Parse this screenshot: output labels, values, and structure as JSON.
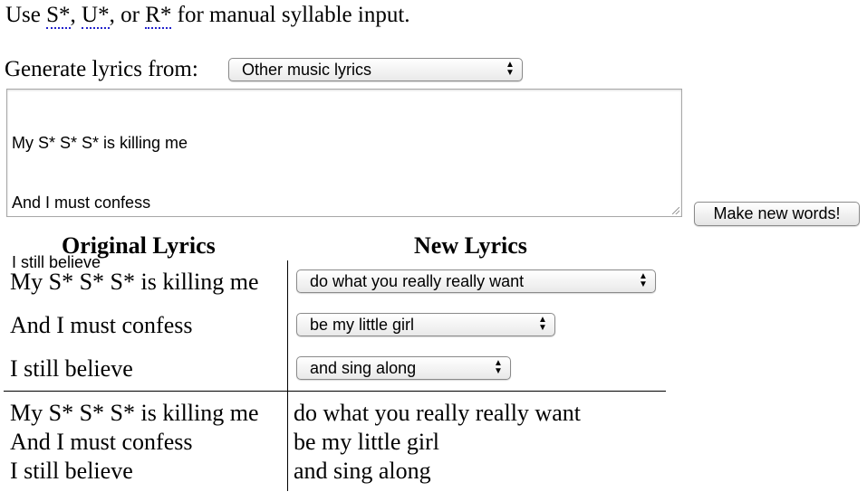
{
  "instructions": {
    "prefix": "Use ",
    "s_code": "S*",
    "sep1": ", ",
    "u_code": "U*",
    "sep2": ", or ",
    "r_code": "R*",
    "suffix": " for manual syllable input."
  },
  "generator": {
    "label": "Generate lyrics from:",
    "selected": "Other music lyrics"
  },
  "input": {
    "lines": [
      "My S* S* S* is killing me",
      "And I must confess",
      "I still believe"
    ]
  },
  "make_button_label": "Make new words!",
  "table": {
    "original_header": "Original Lyrics",
    "new_header": "New Lyrics",
    "rows": [
      {
        "original": "My S* S* S* is killing me",
        "new_selected": "do what you really really want"
      },
      {
        "original": "And I must confess",
        "new_selected": "be my little girl"
      },
      {
        "original": "I still believe",
        "new_selected": "and sing along"
      }
    ]
  },
  "result": {
    "original": [
      "My S* S* S* is killing me",
      "And I must confess",
      "I still believe"
    ],
    "new": [
      "do what you really really want",
      "be my little girl",
      "and sing along"
    ]
  }
}
